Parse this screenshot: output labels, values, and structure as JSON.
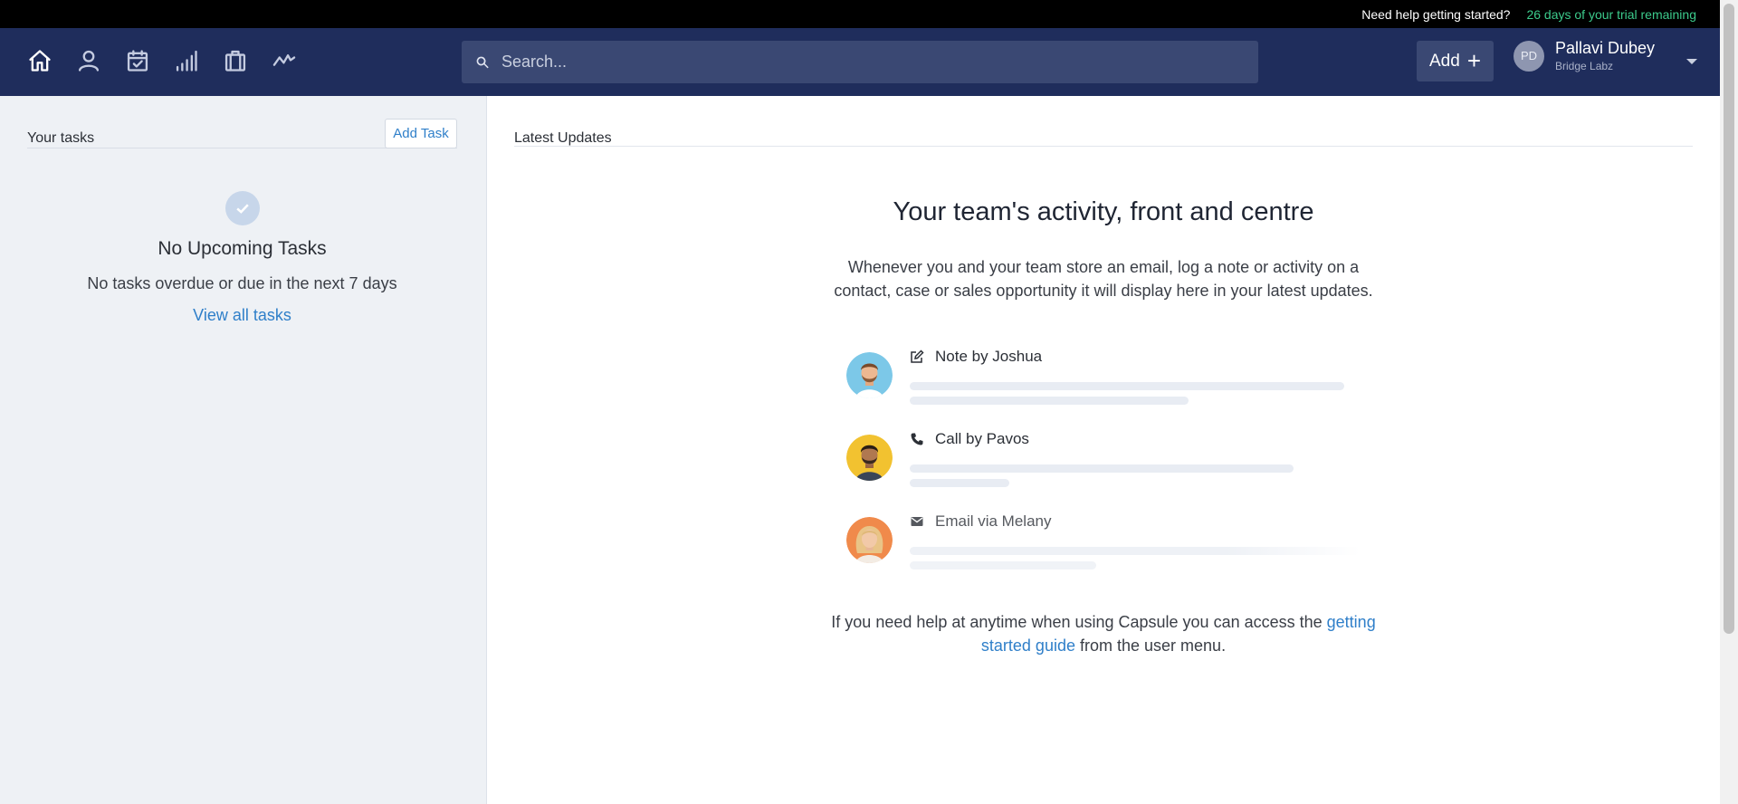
{
  "topbar": {
    "help_text": "Need help getting started?",
    "trial_text": "26 days of your trial remaining",
    "trial_color": "#3ccb8c"
  },
  "navbar": {
    "background": "#1f2d5c",
    "icons": [
      "home-icon",
      "person-icon",
      "calendar-icon",
      "sales-pipeline-icon",
      "cases-icon",
      "activity-icon"
    ],
    "search_placeholder": "Search...",
    "add_label": "Add",
    "user": {
      "initials": "PD",
      "name": "Pallavi Dubey",
      "org": "Bridge Labz"
    }
  },
  "sidebar": {
    "title": "Your tasks",
    "add_task_label": "Add Task",
    "empty_title": "No Upcoming Tasks",
    "empty_subtitle": "No tasks overdue or due in the next 7 days",
    "view_all_label": "View all tasks"
  },
  "main": {
    "section_title": "Latest Updates",
    "hero_title": "Your team's activity, front and centre",
    "hero_description": "Whenever you and your team store an email, log a note or activity on a contact, case or sales opportunity it will display here in your latest updates.",
    "feed": [
      {
        "label": "Note by Joshua",
        "icon": "note-icon",
        "avatar_color": "#7cc8e8"
      },
      {
        "label": "Call by Pavos",
        "icon": "phone-icon",
        "avatar_color": "#f2c230"
      },
      {
        "label": "Email via Melany",
        "icon": "envelope-icon",
        "avatar_color": "#f08a4b"
      }
    ],
    "help_prefix": "If you need help at anytime when using Capsule you can access the",
    "help_link": "getting started guide",
    "help_suffix": "from the user menu.",
    "link_color": "#2f7fc9"
  }
}
